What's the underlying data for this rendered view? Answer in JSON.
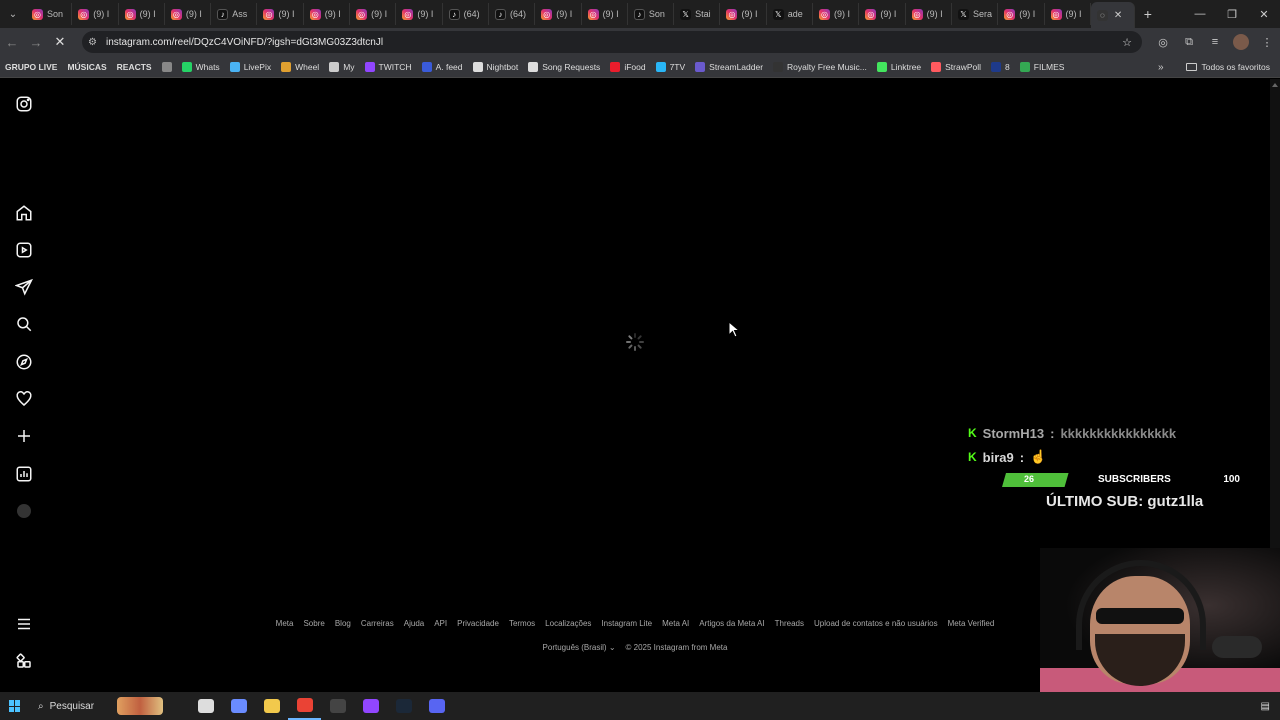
{
  "browser": {
    "tabs": [
      {
        "icon": "instagram-icon",
        "title": "Son"
      },
      {
        "icon": "instagram-icon",
        "title": "(9) I"
      },
      {
        "icon": "instagram-icon",
        "title": "(9) I"
      },
      {
        "icon": "instagram-icon",
        "title": "(9) I"
      },
      {
        "icon": "tiktok-icon",
        "title": "Ass"
      },
      {
        "icon": "instagram-icon",
        "title": "(9) I"
      },
      {
        "icon": "instagram-icon",
        "title": "(9) I"
      },
      {
        "icon": "instagram-icon",
        "title": "(9) I"
      },
      {
        "icon": "instagram-icon",
        "title": "(9) I"
      },
      {
        "icon": "tiktok-icon",
        "title": "(64)"
      },
      {
        "icon": "tiktok-icon",
        "title": "(64)"
      },
      {
        "icon": "instagram-icon",
        "title": "(9) I"
      },
      {
        "icon": "instagram-icon",
        "title": "(9) I"
      },
      {
        "icon": "tiktok-icon",
        "title": "Son"
      },
      {
        "icon": "x-icon",
        "title": "Stai"
      },
      {
        "icon": "instagram-icon",
        "title": "(9) I"
      },
      {
        "icon": "x-icon",
        "title": "ade"
      },
      {
        "icon": "instagram-icon",
        "title": "(9) I"
      },
      {
        "icon": "instagram-icon",
        "title": "(9) I"
      },
      {
        "icon": "instagram-icon",
        "title": "(9) I"
      },
      {
        "icon": "x-icon",
        "title": "Sera"
      },
      {
        "icon": "instagram-icon",
        "title": "(9) I"
      },
      {
        "icon": "instagram-icon",
        "title": "(9) I"
      }
    ],
    "url": "instagram.com/reel/DQzC4VOiNFD/?igsh=dGt3MG03Z3dtcnJl",
    "bookmarks": [
      {
        "label": "GRUPO LIVE",
        "bold": true,
        "color": ""
      },
      {
        "label": "MÚSICAS",
        "bold": true,
        "color": ""
      },
      {
        "label": "REACTS",
        "bold": true,
        "color": ""
      },
      {
        "label": "",
        "bold": false,
        "color": "#888888"
      },
      {
        "label": "Whats",
        "bold": false,
        "color": "#25d366"
      },
      {
        "label": "LivePix",
        "bold": false,
        "color": "#4ab3f4"
      },
      {
        "label": "Wheel",
        "bold": false,
        "color": "#e0a030"
      },
      {
        "label": "My",
        "bold": false,
        "color": "#cccccc"
      },
      {
        "label": "TWITCH",
        "bold": false,
        "color": "#9146ff"
      },
      {
        "label": "A. feed",
        "bold": false,
        "color": "#3a5bd9"
      },
      {
        "label": "Nightbot",
        "bold": false,
        "color": "#dddddd"
      },
      {
        "label": "Song Requests",
        "bold": false,
        "color": "#dddddd"
      },
      {
        "label": "iFood",
        "bold": false,
        "color": "#ea1d2c"
      },
      {
        "label": "7TV",
        "bold": false,
        "color": "#29b6f6"
      },
      {
        "label": "StreamLadder",
        "bold": false,
        "color": "#6a5acd"
      },
      {
        "label": "Royalty Free Music...",
        "bold": false,
        "color": "#333333"
      },
      {
        "label": "Linktree",
        "bold": false,
        "color": "#43e55e"
      },
      {
        "label": "StrawPoll",
        "bold": false,
        "color": "#ff5a5f"
      },
      {
        "label": "8",
        "bold": false,
        "color": "#1e3a8a"
      },
      {
        "label": "FILMES",
        "bold": false,
        "color": "#34a853"
      }
    ],
    "favorites_folder": "Todos os favoritos"
  },
  "instagram": {
    "nav": [
      "instagram-logo-icon",
      "home-icon",
      "reels-icon",
      "direct-message-icon",
      "search-icon",
      "explore-icon",
      "notifications-heart-icon",
      "create-plus-icon",
      "dashboard-icon",
      "profile-icon",
      "more-menu-icon",
      "meta-apps-icon"
    ],
    "footer_links": [
      "Meta",
      "Sobre",
      "Blog",
      "Carreiras",
      "Ajuda",
      "API",
      "Privacidade",
      "Termos",
      "Localizações",
      "Instagram Lite",
      "Meta AI",
      "Artigos da Meta AI",
      "Threads",
      "Upload de contatos e não usuários",
      "Meta Verified"
    ],
    "language": "Português (Brasil)",
    "copyright": "© 2025 Instagram from Meta"
  },
  "stream_overlay": {
    "chat": [
      {
        "user": "StormH13",
        "message": "kkkkkkkkkkkkkkkk"
      },
      {
        "user": "bira9",
        "message": "☝️"
      }
    ],
    "subs_current": "26",
    "subs_label": "SUBSCRIBERS",
    "subs_goal": "100",
    "subs_progress": 0.26,
    "last_sub": "ÚLTIMO SUB: gutz1lla"
  },
  "taskbar": {
    "search_placeholder": "Pesquisar",
    "apps": [
      {
        "name": "task-view-icon",
        "color": "#dddddd"
      },
      {
        "name": "copilot-icon",
        "color": "#6a8cff"
      },
      {
        "name": "file-explorer-icon",
        "color": "#f2c94c"
      },
      {
        "name": "chrome-icon",
        "color": "#ea4335"
      },
      {
        "name": "obs-icon",
        "color": "#444444"
      },
      {
        "name": "twitch-app-icon",
        "color": "#9146ff"
      },
      {
        "name": "steam-icon",
        "color": "#1b2838"
      },
      {
        "name": "discord-icon",
        "color": "#5865f2"
      }
    ]
  }
}
